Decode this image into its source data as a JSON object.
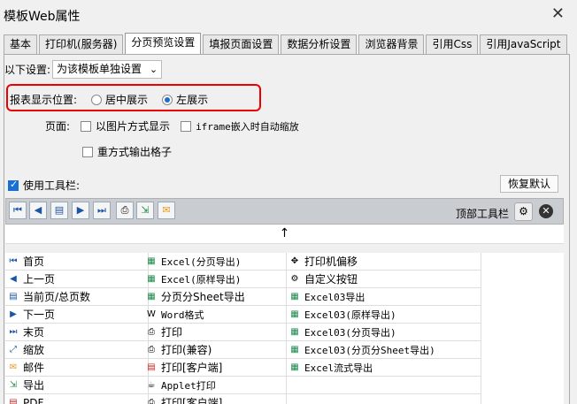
{
  "window": {
    "title": "模板Web属性",
    "close": "✕"
  },
  "tabs": [
    "基本",
    "打印机(服务器)",
    "分页预览设置",
    "填报页面设置",
    "数据分析设置",
    "浏览器背景",
    "引用Css",
    "引用JavaScript"
  ],
  "settings": {
    "scope_label": "以下设置:",
    "scope_value": "为该模板单独设置",
    "position_label": "报表显示位置:",
    "position_center": "居中展示",
    "position_left": "左展示",
    "page_label": "页面:",
    "as_image": "以图片方式显示",
    "iframe_zoom": "iframe嵌入时自动缩放",
    "redo_output": "重方式输出格子",
    "use_toolbar": "使用工具栏:",
    "restore_default": "恢复默认",
    "top_toolbar": "顶部工具栏"
  },
  "up_arrow": "↑",
  "grid": {
    "col1": [
      "首页",
      "上一页",
      "当前页/总页数",
      "下一页",
      "末页",
      "缩放",
      "邮件",
      "导出",
      "PDF"
    ],
    "col2": [
      "Excel(分页导出)",
      "Excel(原样导出)",
      "分页分Sheet导出",
      "Word格式",
      "打印",
      "打印(兼容)",
      "打印[客户端]",
      "Applet打印",
      "打印[客户端]"
    ],
    "col3": [
      "打印机偏移",
      "自定义按钮",
      "Excel03导出",
      "Excel03(原样导出)",
      "Excel03(分页导出)",
      "Excel03(分页分Sheet导出)",
      "Excel流式导出"
    ]
  }
}
